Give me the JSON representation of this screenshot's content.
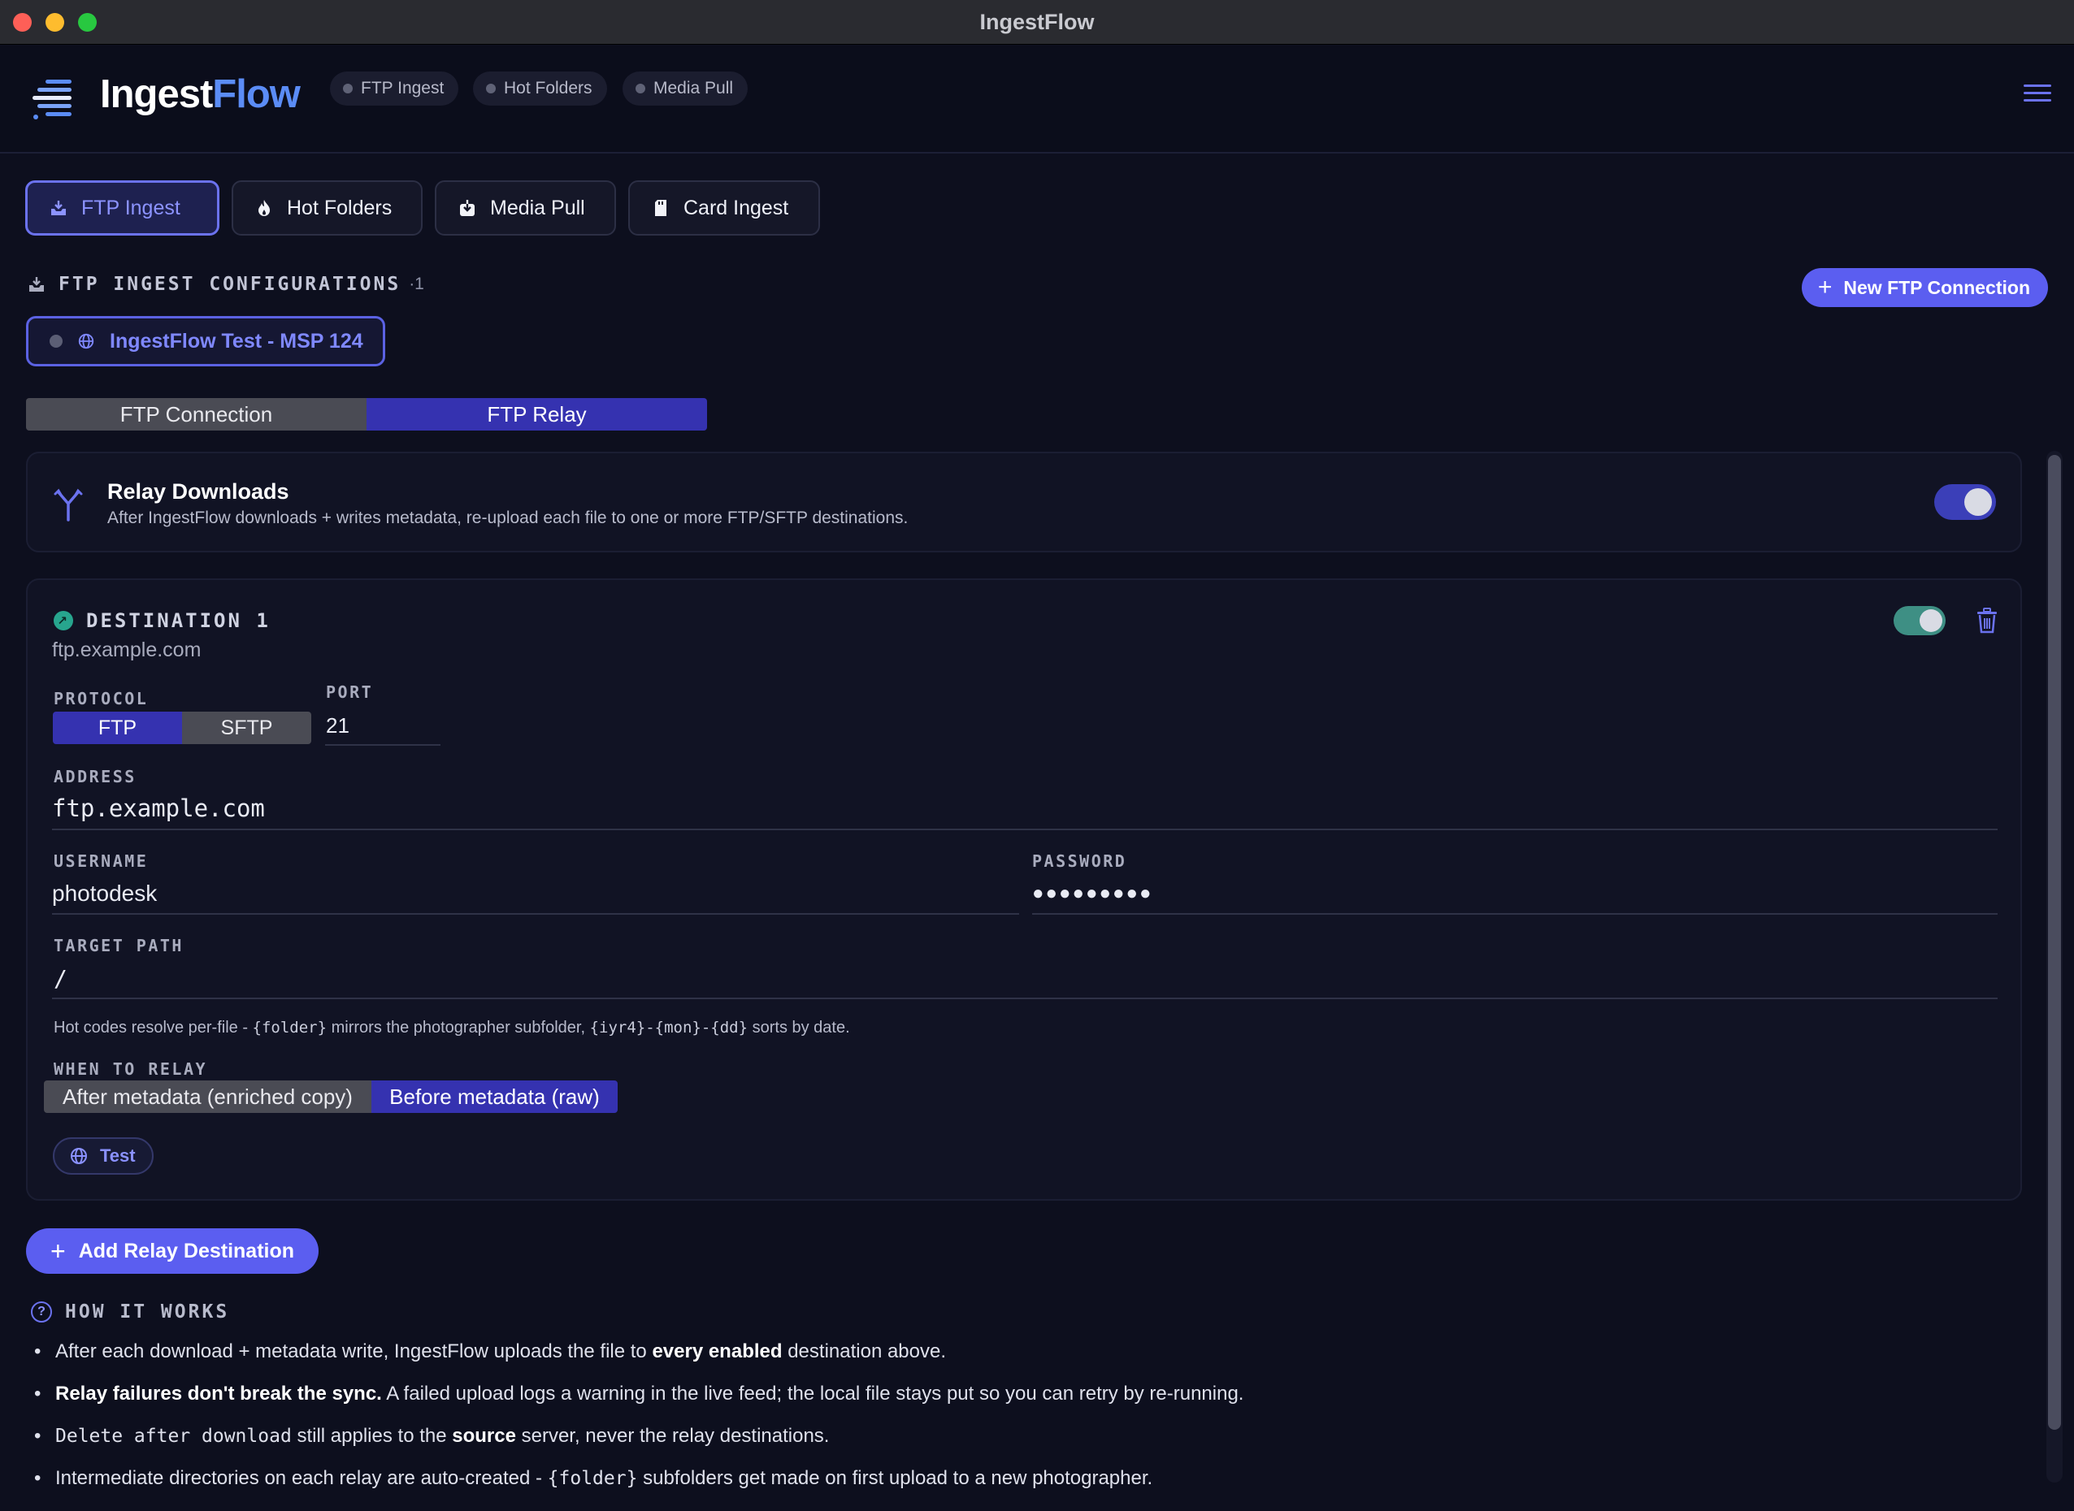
{
  "window": {
    "title": "IngestFlow"
  },
  "brand": {
    "part1": "Ingest",
    "part2": "Flow"
  },
  "header_pills": [
    "FTP Ingest",
    "Hot Folders",
    "Media Pull"
  ],
  "tabs": [
    {
      "label": "FTP Ingest",
      "icon": "inbox-icon"
    },
    {
      "label": "Hot Folders",
      "icon": "flame-icon"
    },
    {
      "label": "Media Pull",
      "icon": "download-icon"
    },
    {
      "label": "Card Ingest",
      "icon": "sd-card-icon"
    }
  ],
  "section": {
    "title": "FTP INGEST CONFIGURATIONS",
    "count": "·1",
    "new_button": "New FTP Connection"
  },
  "config_chip": {
    "label": "IngestFlow Test - MSP 124"
  },
  "subtabs": [
    "FTP Connection",
    "FTP Relay"
  ],
  "relay": {
    "title": "Relay Downloads",
    "description": "After IngestFlow downloads + writes metadata, re-upload each file to one or more FTP/SFTP destinations.",
    "enabled": true
  },
  "destination": {
    "heading": "DESTINATION 1",
    "host": "ftp.example.com",
    "enabled": true,
    "protocol_label": "PROTOCOL",
    "protocols": [
      "FTP",
      "SFTP"
    ],
    "protocol_selected": "FTP",
    "port_label": "PORT",
    "port": "21",
    "address_label": "ADDRESS",
    "address": "ftp.example.com",
    "username_label": "USERNAME",
    "username": "photodesk",
    "password_label": "PASSWORD",
    "password": "●●●●●●●●●",
    "target_label": "TARGET PATH",
    "target": "/",
    "hint_pre": "Hot codes resolve per-file - ",
    "hint_code1": "{folder}",
    "hint_mid": " mirrors the photographer subfolder, ",
    "hint_code2": "{iyr4}-{mon}-{dd}",
    "hint_post": " sorts by date.",
    "when_label": "WHEN TO RELAY",
    "when_options": [
      "After metadata (enriched copy)",
      "Before metadata (raw)"
    ],
    "when_selected": "Before metadata (raw)",
    "test_button": "Test"
  },
  "add_button": "Add Relay Destination",
  "how": {
    "title": "HOW IT WORKS",
    "b1_pre": "After each download + metadata write, IngestFlow uploads the file to ",
    "b1_bold": "every enabled",
    "b1_post": " destination above.",
    "b2_bold": "Relay failures don't break the sync.",
    "b2_post": " A failed upload logs a warning in the live feed; the local file stays put so you can retry by re-running.",
    "b3_code": "Delete after download",
    "b3_mid": " still applies to the ",
    "b3_bold": "source",
    "b3_post": " server, never the relay destinations.",
    "b4_pre": "Intermediate directories on each relay are auto-created - ",
    "b4_code": "{folder}",
    "b4_post": " subfolders get made on first upload to a new photographer."
  },
  "colors": {
    "accent": "#5b5ef0",
    "brand_blue": "#5b8cf6",
    "teal": "#27a58e",
    "background": "#0d0f1e"
  }
}
